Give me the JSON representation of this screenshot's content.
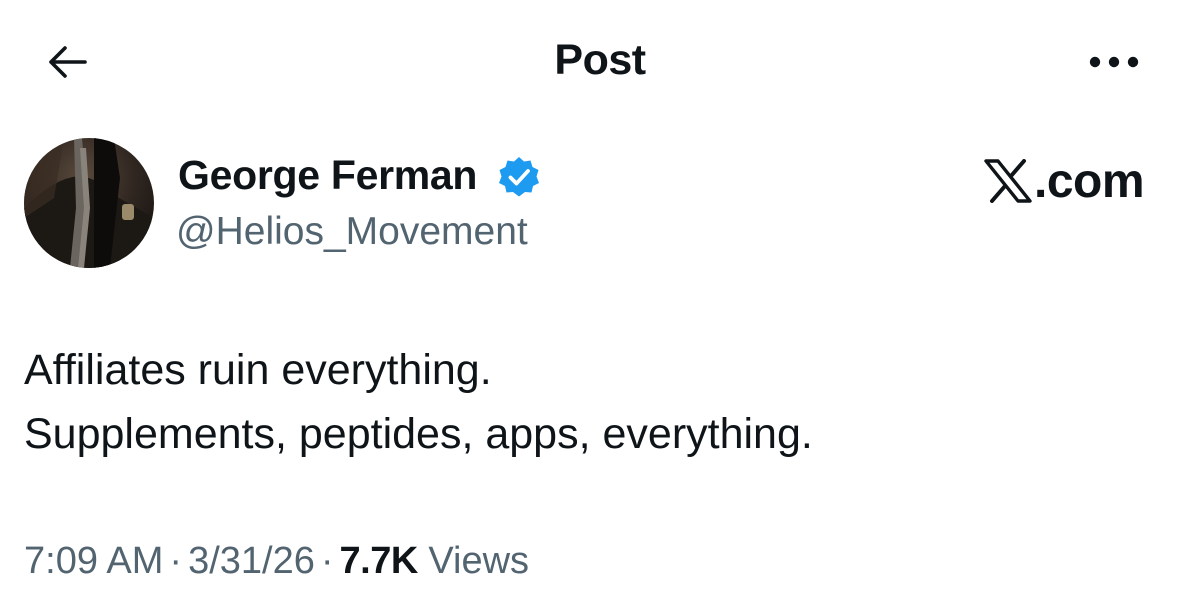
{
  "header": {
    "title": "Post",
    "back_icon": "arrow-left-icon",
    "more_icon": "more-horizontal-icon"
  },
  "author": {
    "name": "George Ferman",
    "handle": "@Helios_Movement",
    "verified": true,
    "verified_color": "#1d9bf0"
  },
  "brand": {
    "logo_icon": "x-logo-icon",
    "text": ".com"
  },
  "tweet": {
    "lines": [
      "Affiliates ruin everything.",
      "Supplements, peptides, apps, everything."
    ]
  },
  "meta": {
    "time": "7:09 AM",
    "date": "3/31/26",
    "separator": "·",
    "views_count": "7.7K",
    "views_label": "Views"
  },
  "colors": {
    "text_primary": "#0f1419",
    "text_secondary": "#536471",
    "background": "#ffffff"
  }
}
